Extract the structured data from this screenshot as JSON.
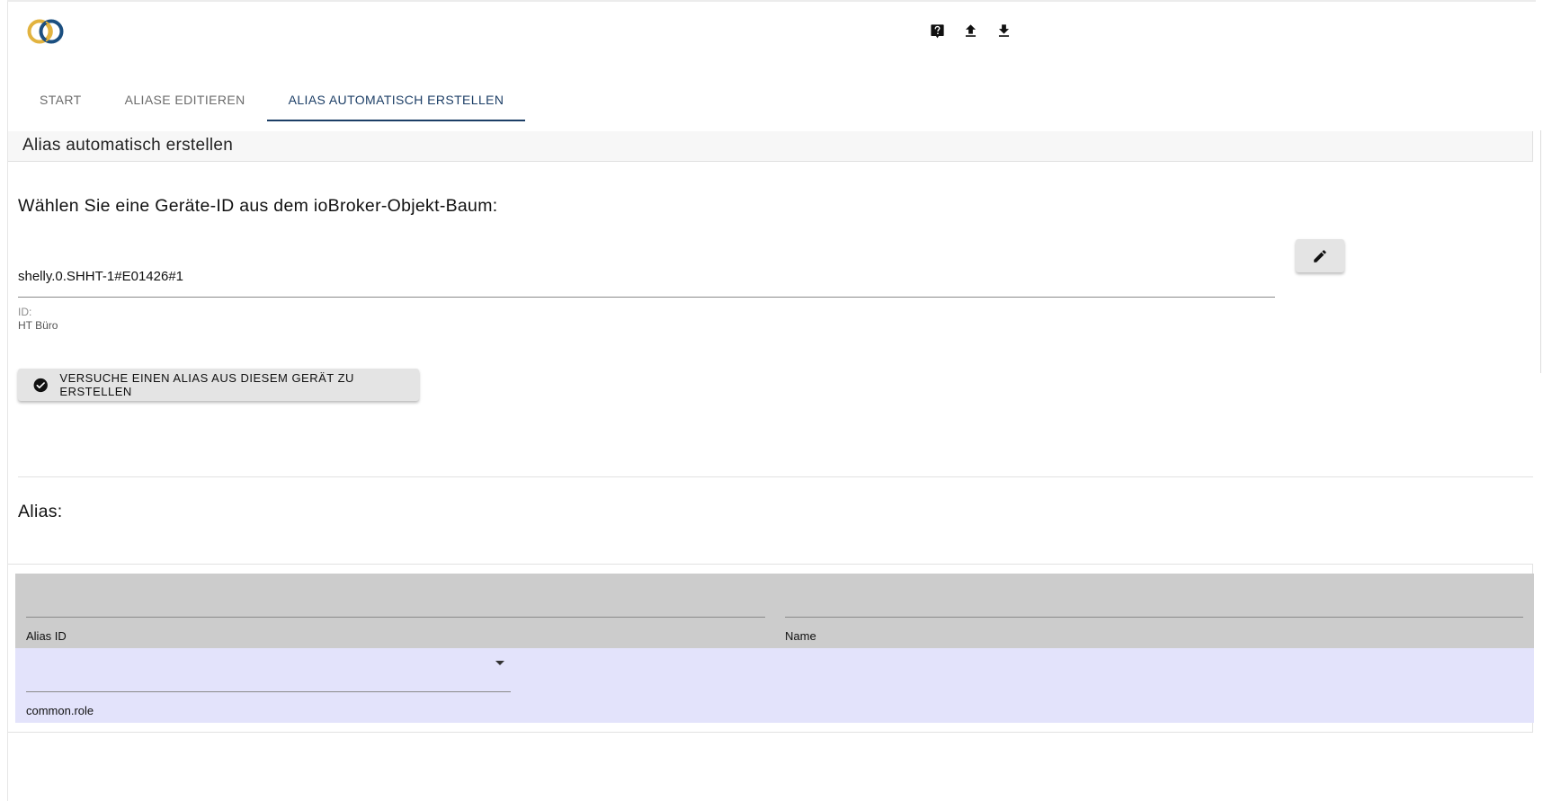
{
  "header": {
    "logo": "iobroker-logo",
    "actions": [
      {
        "name": "help-icon"
      },
      {
        "name": "upload-icon"
      },
      {
        "name": "download-icon"
      }
    ]
  },
  "tabs": [
    {
      "label": "START",
      "active": false
    },
    {
      "label": "ALIASE EDITIEREN",
      "active": false
    },
    {
      "label": "ALIAS AUTOMATISCH ERSTELLEN",
      "active": true
    }
  ],
  "panel": {
    "title": "Alias automatisch erstellen",
    "select_prompt": "Wählen Sie eine Geräte-ID aus dem ioBroker-Objekt-Baum:",
    "device_id": "shelly.0.SHHT-1#E01426#1",
    "id_caption": "ID:",
    "device_name": "HT Büro",
    "create_button": "VERSUCHE EINEN ALIAS AUS DIESEM GERÄT ZU ERSTELLEN",
    "alias_label": "Alias:"
  },
  "alias_table": {
    "alias_id_label": "Alias ID",
    "alias_id_value": "",
    "name_label": "Name",
    "name_value": "",
    "role_label": "common.role",
    "role_value": ""
  },
  "colors": {
    "accent": "#1c3e66",
    "header_row": "#cccccc",
    "alias_row": "#e3e3fb"
  }
}
